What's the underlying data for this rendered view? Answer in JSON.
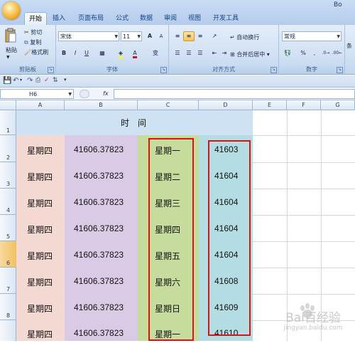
{
  "window_title": "Bo",
  "tabs": [
    "开始",
    "插入",
    "页面布局",
    "公式",
    "数据",
    "审阅",
    "视图",
    "开发工具"
  ],
  "ribbon": {
    "clipboard": {
      "paste": "粘贴",
      "cut": "剪切",
      "copy": "复制",
      "format_painter": "格式刷",
      "label": "剪贴板"
    },
    "font": {
      "name": "宋体",
      "size": "11",
      "grow": "A",
      "shrink": "A",
      "bold": "B",
      "italic": "I",
      "underline": "U",
      "label": "字体",
      "wen": "变"
    },
    "alignment": {
      "wrap": "自动换行",
      "merge": "合并后居中",
      "label": "对齐方式"
    },
    "number": {
      "format": "常规",
      "percent": "%",
      "comma": ",",
      "label": "数字"
    },
    "styles_partial": "条"
  },
  "formula_bar": {
    "name_box": "H6",
    "fx": "fx",
    "value": ""
  },
  "columns": [
    "A",
    "B",
    "C",
    "D",
    "E",
    "F",
    "G"
  ],
  "rows": [
    "1",
    "2",
    "3",
    "4",
    "5",
    "6",
    "7",
    "8"
  ],
  "sheet": {
    "header_title": "时　间",
    "col_a": [
      "星期四",
      "星期四",
      "星期四",
      "星期四",
      "星期四",
      "星期四",
      "星期四",
      "星期四"
    ],
    "col_b": [
      "41606.37823",
      "41606.37823",
      "41606.37823",
      "41606.37823",
      "41606.37823",
      "41606.37823",
      "41606.37823",
      "41606.37823"
    ],
    "col_c": [
      "星期一",
      "星期二",
      "星期三",
      "星期四",
      "星期五",
      "星期六",
      "星期日",
      "星期一"
    ],
    "col_d": [
      "41603",
      "41604",
      "41604",
      "41604",
      "41604",
      "41608",
      "41609",
      "41610"
    ]
  },
  "colors": {
    "col_a": "#f4d8d2",
    "col_b": "#d9cbe6",
    "col_c": "#c6dc9d",
    "col_d": "#b4dde3",
    "header": "#cfe2f3",
    "highlight": "#e01010"
  },
  "watermark": {
    "brand": "Bai百经验",
    "url": "jingyan.baidu.com"
  }
}
